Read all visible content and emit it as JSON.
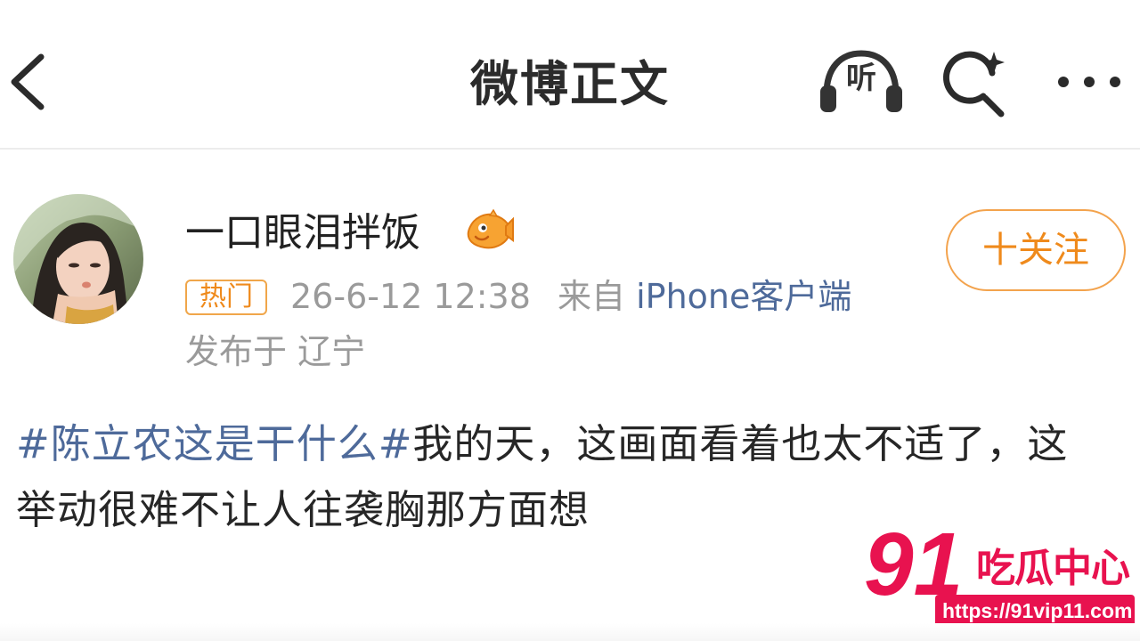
{
  "header": {
    "title": "微博正文",
    "listen_label": "听",
    "back_icon": "chevron-left-icon",
    "listen_icon": "headphones-icon",
    "search_icon": "search-sparkle-icon",
    "more_icon": "more-horizontal-icon"
  },
  "author": {
    "name": "一口眼泪拌饭",
    "badge_icon": "fish-badge-icon",
    "hot_tag": "热门",
    "time": "26-6-12 12:38",
    "from_prefix": "来自",
    "client": "iPhone客户端",
    "location": "发布于 辽宁",
    "follow_label": "十关注"
  },
  "post": {
    "topic": "#陈立农这是干什么#",
    "text": "我的天，这画面看着也太不适了，这举动很难不让人往袭胸那方面想"
  },
  "watermark": {
    "number": "91",
    "name": "吃瓜中心",
    "url": "https://91vip11.com"
  },
  "colors": {
    "accent_orange": "#ef8a1c",
    "link_blue": "#4e6a9a",
    "watermark_red": "#e8124f",
    "meta_gray": "#9a9a9a"
  }
}
